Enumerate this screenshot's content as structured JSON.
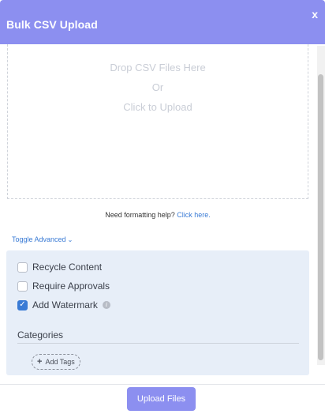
{
  "modal": {
    "title": "Bulk CSV Upload",
    "close_label": "x"
  },
  "dropzone": {
    "line1": "Drop CSV Files Here",
    "line2": "Or",
    "line3": "Click to Upload"
  },
  "help": {
    "text": "Need formatting help?",
    "link": "Click here."
  },
  "advanced": {
    "toggle_label": "Toggle Advanced",
    "options": [
      {
        "label": "Recycle Content",
        "checked": false
      },
      {
        "label": "Require Approvals",
        "checked": false
      },
      {
        "label": "Add Watermark",
        "checked": true
      }
    ],
    "categories_title": "Categories",
    "add_tags_label": "Add Tags"
  },
  "footer": {
    "upload_label": "Upload Files"
  },
  "colors": {
    "accent": "#8c8ff0",
    "link": "#3a7bd5",
    "panel": "#e7eef8"
  }
}
